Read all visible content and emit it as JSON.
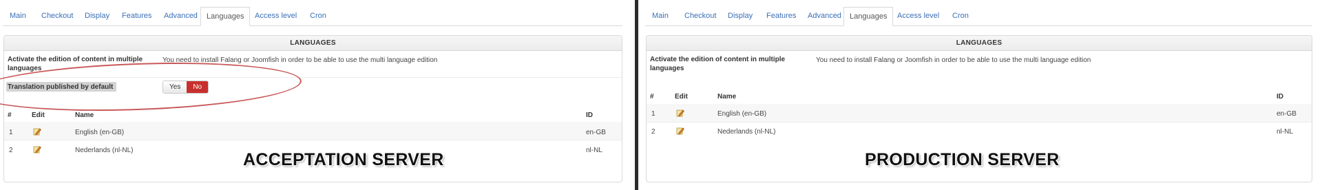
{
  "acceptation": {
    "tabs": [
      {
        "label": "Main"
      },
      {
        "label": "Checkout"
      },
      {
        "label": "Display"
      },
      {
        "label": "Features"
      },
      {
        "label": "Advanced"
      },
      {
        "label": "Languages",
        "active": true
      },
      {
        "label": "Access level"
      },
      {
        "label": "Cron"
      }
    ],
    "panel_title": "LANGUAGES",
    "activate_label": "Activate the edition of content in multiple languages",
    "activate_text": "You need to install Falang or Joomfish in order to be able to use the multi language edition",
    "translation_label": "Translation published by default",
    "toggle": {
      "yes": "Yes",
      "no": "No",
      "selected": "No"
    },
    "columns": {
      "num": "#",
      "edit": "Edit",
      "name": "Name",
      "id": "ID"
    },
    "rows": [
      {
        "num": "1",
        "name": "English (en-GB)",
        "id": "en-GB"
      },
      {
        "num": "2",
        "name": "Nederlands (nl-NL)",
        "id": "nl-NL"
      }
    ],
    "caption": "ACCEPTATION SERVER"
  },
  "production": {
    "tabs": [
      {
        "label": "Main"
      },
      {
        "label": "Checkout"
      },
      {
        "label": "Display"
      },
      {
        "label": "Features"
      },
      {
        "label": "Advanced"
      },
      {
        "label": "Languages",
        "active": true
      },
      {
        "label": "Access level"
      },
      {
        "label": "Cron"
      }
    ],
    "panel_title": "LANGUAGES",
    "activate_label": "Activate the edition of content in multiple languages",
    "activate_text": "You need to install Falang or Joomfish in order to be able to use the multi language edition",
    "columns": {
      "num": "#",
      "edit": "Edit",
      "name": "Name",
      "id": "ID"
    },
    "rows": [
      {
        "num": "1",
        "name": "English (en-GB)",
        "id": "en-GB"
      },
      {
        "num": "2",
        "name": "Nederlands (nl-NL)",
        "id": "nl-NL"
      }
    ],
    "caption": "PRODUCTION SERVER"
  },
  "colors": {
    "accent_link": "#3b6fb6",
    "no_button": "#c8302d",
    "annotation": "#c9595a"
  },
  "icons": {
    "edit": "pencil-edit-icon"
  }
}
